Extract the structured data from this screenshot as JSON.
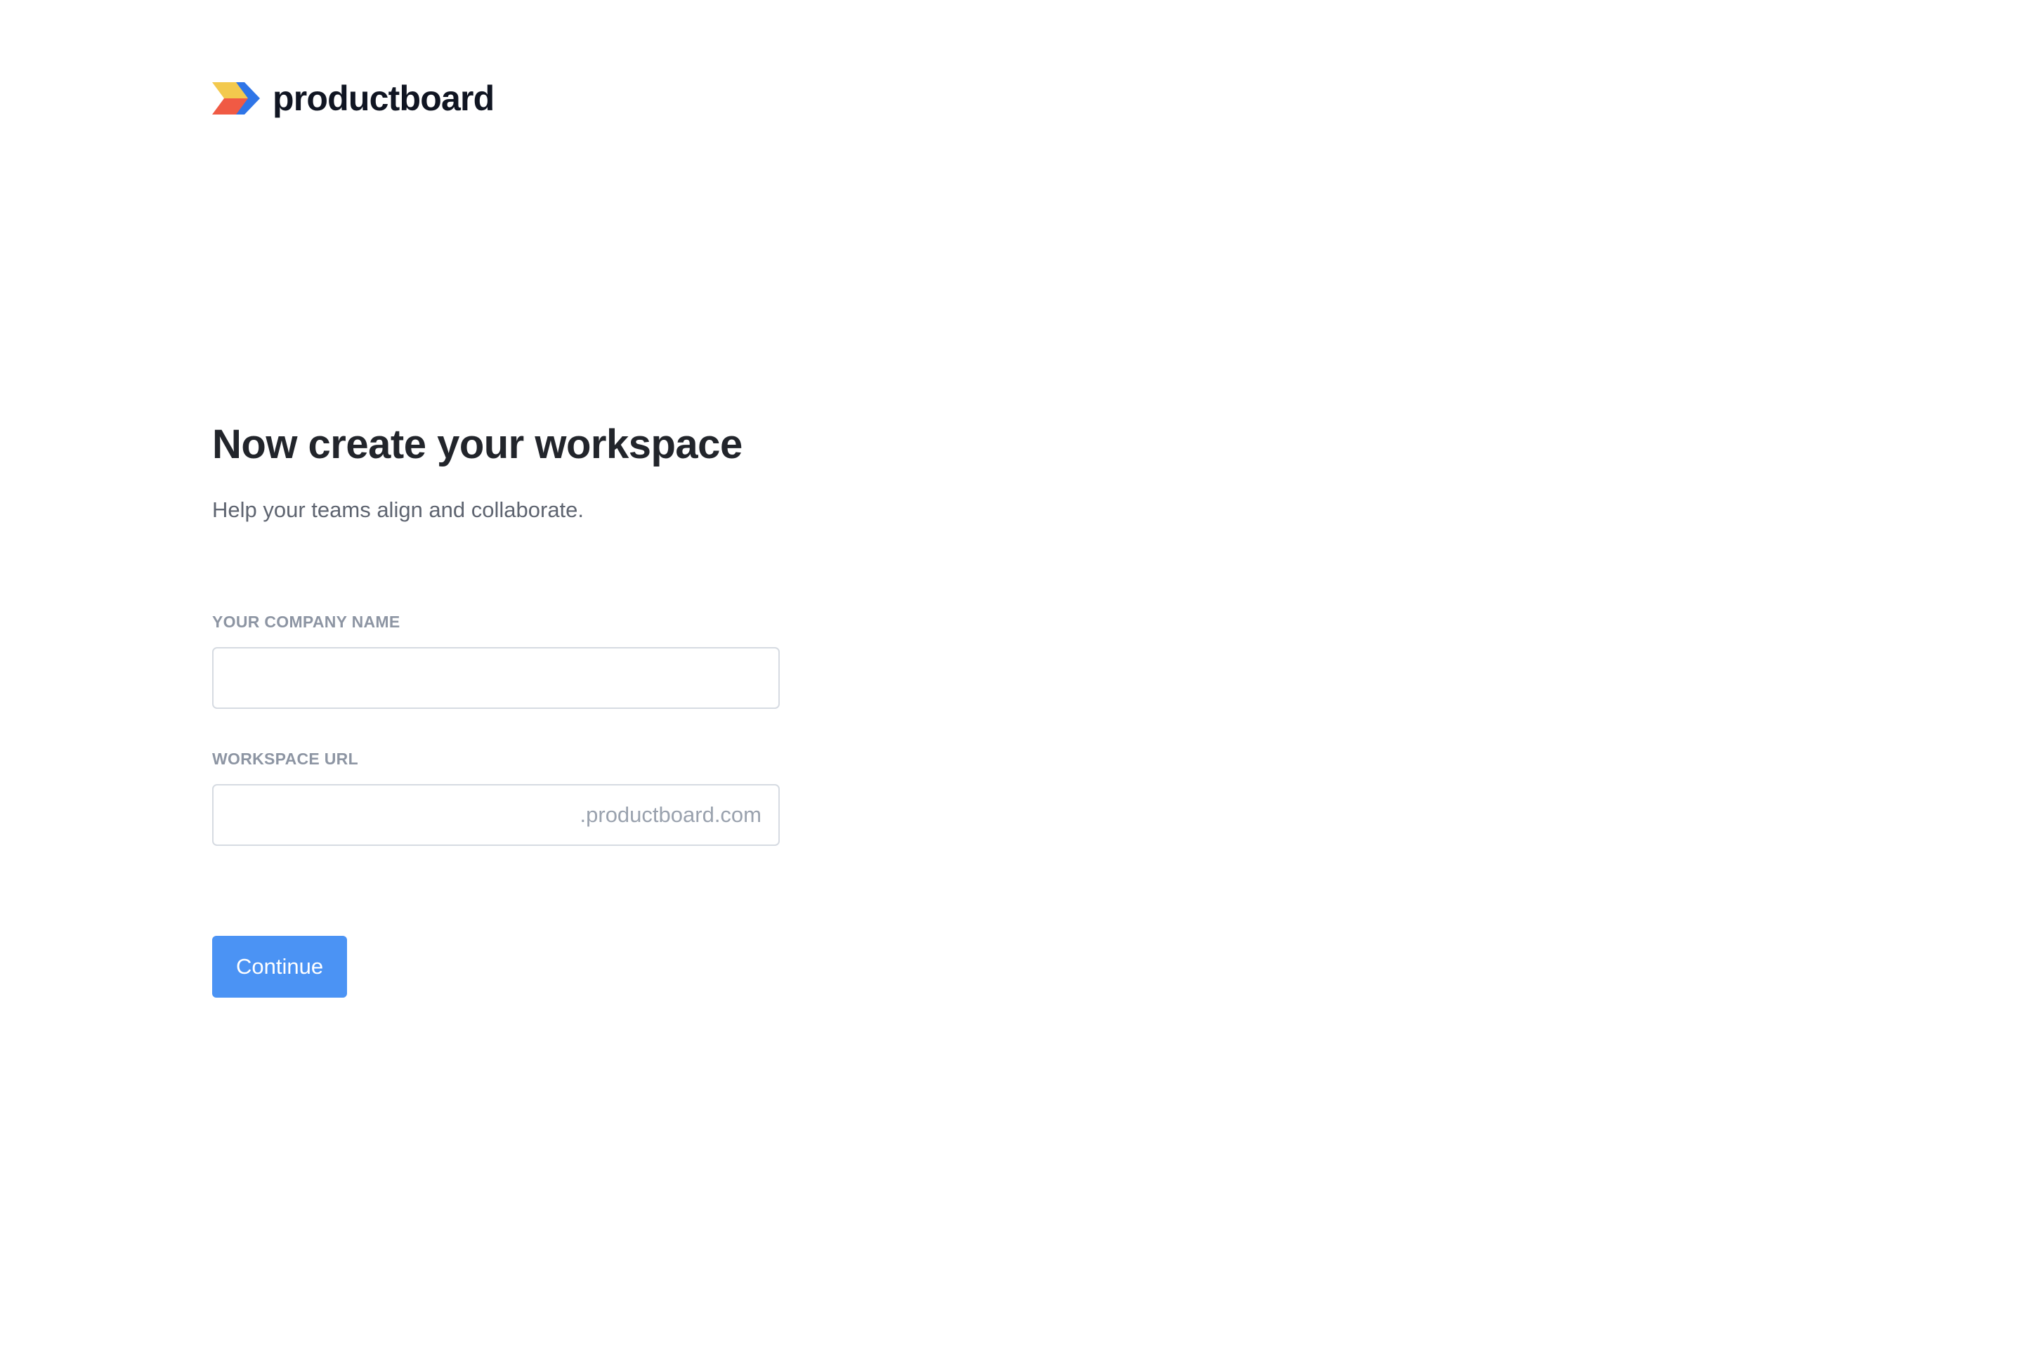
{
  "brand": {
    "name": "productboard",
    "logo_icon": "productboard-logo-icon",
    "logo_colors": {
      "yellow": "#f3c94d",
      "red": "#f05a44",
      "blue": "#2f75e7"
    }
  },
  "main": {
    "title": "Now create your workspace",
    "subtitle": "Help your teams align and collaborate."
  },
  "form": {
    "company_name": {
      "label": "YOUR COMPANY NAME",
      "value": "",
      "placeholder": ""
    },
    "workspace_url": {
      "label": "WORKSPACE URL",
      "value": "",
      "placeholder": "",
      "suffix": ".productboard.com"
    },
    "continue_label": "Continue"
  },
  "colors": {
    "primary_button": "#4b93f4",
    "input_border": "#d6dbe2",
    "label_text": "#8d95a3"
  }
}
